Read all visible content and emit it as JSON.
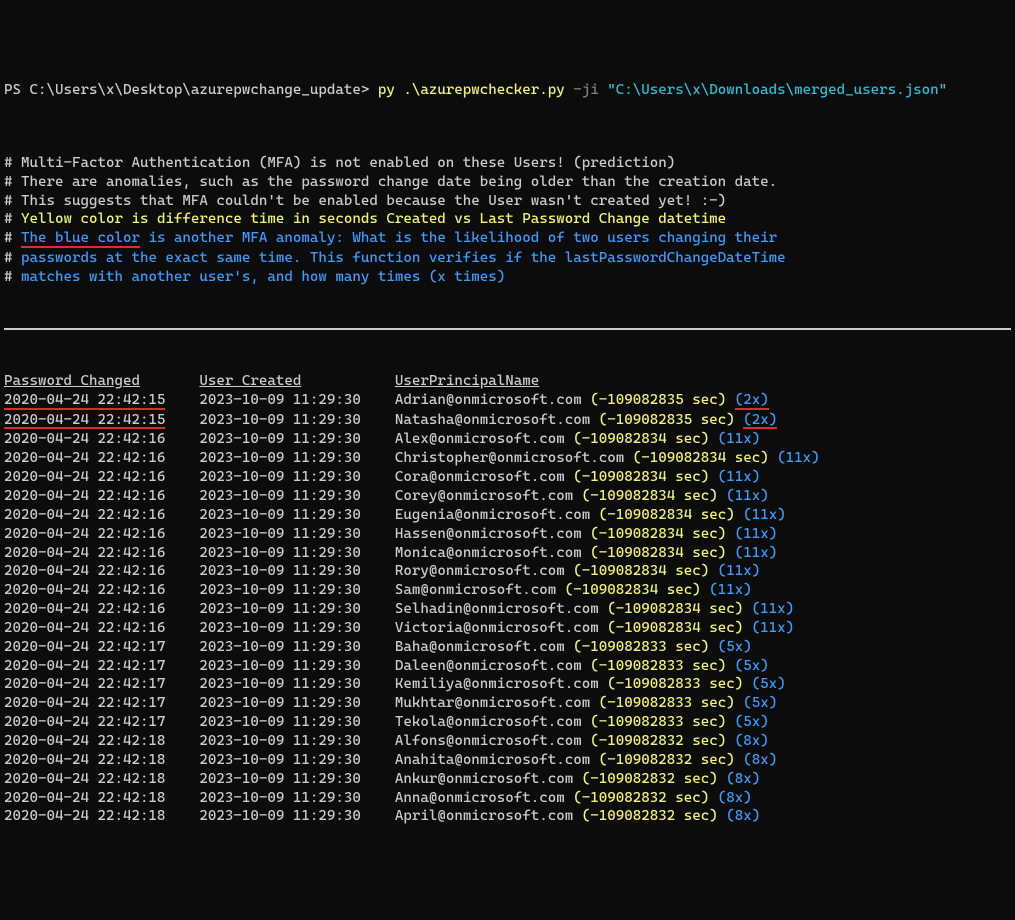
{
  "prompt": {
    "ps": "PS ",
    "path": "C:\\Users\\x\\Desktop\\azurepwchange_update>",
    "cmd": " py .\\azurepwchecker.py",
    "flag": " -ji ",
    "arg": "\"C:\\Users\\x\\Downloads\\merged_users.json\""
  },
  "comments": [
    {
      "type": "plain",
      "text": "Multi-Factor Authentication (MFA) is not enabled on these Users! (prediction)"
    },
    {
      "type": "plain",
      "text": "There are anomalies, such as the password change date being older than the creation date."
    },
    {
      "type": "plain",
      "text": "This suggests that MFA couldn't be enabled because the User wasn't created yet! :-)"
    },
    {
      "type": "yellow",
      "text": "Yellow color is difference time in seconds Created vs Last Password Change datetime"
    },
    {
      "type": "blue-lead",
      "lead": "The blue color",
      "rest": " is another MFA anomaly: What is the likelihood of two users changing their"
    },
    {
      "type": "blue",
      "text": "passwords at the exact same time. This function verifies if the lastPasswordChangeDateTime"
    },
    {
      "type": "blue",
      "text": "matches with another user's, and how many times (x times)"
    }
  ],
  "headers": {
    "c1": "Password Changed",
    "c2": "User Created",
    "c3": "UserPrincipalName"
  },
  "rows": [
    {
      "hl": true,
      "pwchg": "2020-04-24 22:42:15",
      "created": "2023-10-09 11:29:30",
      "upn": "Adrian@onmicrosoft.com",
      "sec": "(-109082835 sec)",
      "dup": "(2x)"
    },
    {
      "hl": true,
      "pwchg": "2020-04-24 22:42:15",
      "created": "2023-10-09 11:29:30",
      "upn": "Natasha@onmicrosoft.com",
      "sec": "(-109082835 sec)",
      "dup": "(2x)"
    },
    {
      "hl": false,
      "pwchg": "2020-04-24 22:42:16",
      "created": "2023-10-09 11:29:30",
      "upn": "Alex@onmicrosoft.com",
      "sec": "(-109082834 sec)",
      "dup": "(11x)"
    },
    {
      "hl": false,
      "pwchg": "2020-04-24 22:42:16",
      "created": "2023-10-09 11:29:30",
      "upn": "Christopher@onmicrosoft.com",
      "sec": "(-109082834 sec)",
      "dup": "(11x)"
    },
    {
      "hl": false,
      "pwchg": "2020-04-24 22:42:16",
      "created": "2023-10-09 11:29:30",
      "upn": "Cora@onmicrosoft.com",
      "sec": "(-109082834 sec)",
      "dup": "(11x)"
    },
    {
      "hl": false,
      "pwchg": "2020-04-24 22:42:16",
      "created": "2023-10-09 11:29:30",
      "upn": "Corey@onmicrosoft.com",
      "sec": "(-109082834 sec)",
      "dup": "(11x)"
    },
    {
      "hl": false,
      "pwchg": "2020-04-24 22:42:16",
      "created": "2023-10-09 11:29:30",
      "upn": "Eugenia@onmicrosoft.com",
      "sec": "(-109082834 sec)",
      "dup": "(11x)"
    },
    {
      "hl": false,
      "pwchg": "2020-04-24 22:42:16",
      "created": "2023-10-09 11:29:30",
      "upn": "Hassen@onmicrosoft.com",
      "sec": "(-109082834 sec)",
      "dup": "(11x)"
    },
    {
      "hl": false,
      "pwchg": "2020-04-24 22:42:16",
      "created": "2023-10-09 11:29:30",
      "upn": "Monica@onmicrosoft.com",
      "sec": "(-109082834 sec)",
      "dup": "(11x)"
    },
    {
      "hl": false,
      "pwchg": "2020-04-24 22:42:16",
      "created": "2023-10-09 11:29:30",
      "upn": "Rory@onmicrosoft.com",
      "sec": "(-109082834 sec)",
      "dup": "(11x)"
    },
    {
      "hl": false,
      "pwchg": "2020-04-24 22:42:16",
      "created": "2023-10-09 11:29:30",
      "upn": "Sam@onmicrosoft.com",
      "sec": "(-109082834 sec)",
      "dup": "(11x)"
    },
    {
      "hl": false,
      "pwchg": "2020-04-24 22:42:16",
      "created": "2023-10-09 11:29:30",
      "upn": "Selhadin@onmicrosoft.com",
      "sec": "(-109082834 sec)",
      "dup": "(11x)"
    },
    {
      "hl": false,
      "pwchg": "2020-04-24 22:42:16",
      "created": "2023-10-09 11:29:30",
      "upn": "Victoria@onmicrosoft.com",
      "sec": "(-109082834 sec)",
      "dup": "(11x)"
    },
    {
      "hl": false,
      "pwchg": "2020-04-24 22:42:17",
      "created": "2023-10-09 11:29:30",
      "upn": "Baha@onmicrosoft.com",
      "sec": "(-109082833 sec)",
      "dup": "(5x)"
    },
    {
      "hl": false,
      "pwchg": "2020-04-24 22:42:17",
      "created": "2023-10-09 11:29:30",
      "upn": "Daleen@onmicrosoft.com",
      "sec": "(-109082833 sec)",
      "dup": "(5x)"
    },
    {
      "hl": false,
      "pwchg": "2020-04-24 22:42:17",
      "created": "2023-10-09 11:29:30",
      "upn": "Kemiliya@onmicrosoft.com",
      "sec": "(-109082833 sec)",
      "dup": "(5x)"
    },
    {
      "hl": false,
      "pwchg": "2020-04-24 22:42:17",
      "created": "2023-10-09 11:29:30",
      "upn": "Mukhtar@onmicrosoft.com",
      "sec": "(-109082833 sec)",
      "dup": "(5x)"
    },
    {
      "hl": false,
      "pwchg": "2020-04-24 22:42:17",
      "created": "2023-10-09 11:29:30",
      "upn": "Tekola@onmicrosoft.com",
      "sec": "(-109082833 sec)",
      "dup": "(5x)"
    },
    {
      "hl": false,
      "pwchg": "2020-04-24 22:42:18",
      "created": "2023-10-09 11:29:30",
      "upn": "Alfons@onmicrosoft.com",
      "sec": "(-109082832 sec)",
      "dup": "(8x)"
    },
    {
      "hl": false,
      "pwchg": "2020-04-24 22:42:18",
      "created": "2023-10-09 11:29:30",
      "upn": "Anahita@onmicrosoft.com",
      "sec": "(-109082832 sec)",
      "dup": "(8x)"
    },
    {
      "hl": false,
      "pwchg": "2020-04-24 22:42:18",
      "created": "2023-10-09 11:29:30",
      "upn": "Ankur@onmicrosoft.com",
      "sec": "(-109082832 sec)",
      "dup": "(8x)"
    },
    {
      "hl": false,
      "pwchg": "2020-04-24 22:42:18",
      "created": "2023-10-09 11:29:30",
      "upn": "Anna@onmicrosoft.com",
      "sec": "(-109082832 sec)",
      "dup": "(8x)"
    },
    {
      "hl": false,
      "pwchg": "2020-04-24 22:42:18",
      "created": "2023-10-09 11:29:30",
      "upn": "April@onmicrosoft.com",
      "sec": "(-109082832 sec)",
      "dup": "(8x)"
    }
  ],
  "cols": {
    "c1pad": 23,
    "c2pad": 23,
    "upnpad": 28
  }
}
